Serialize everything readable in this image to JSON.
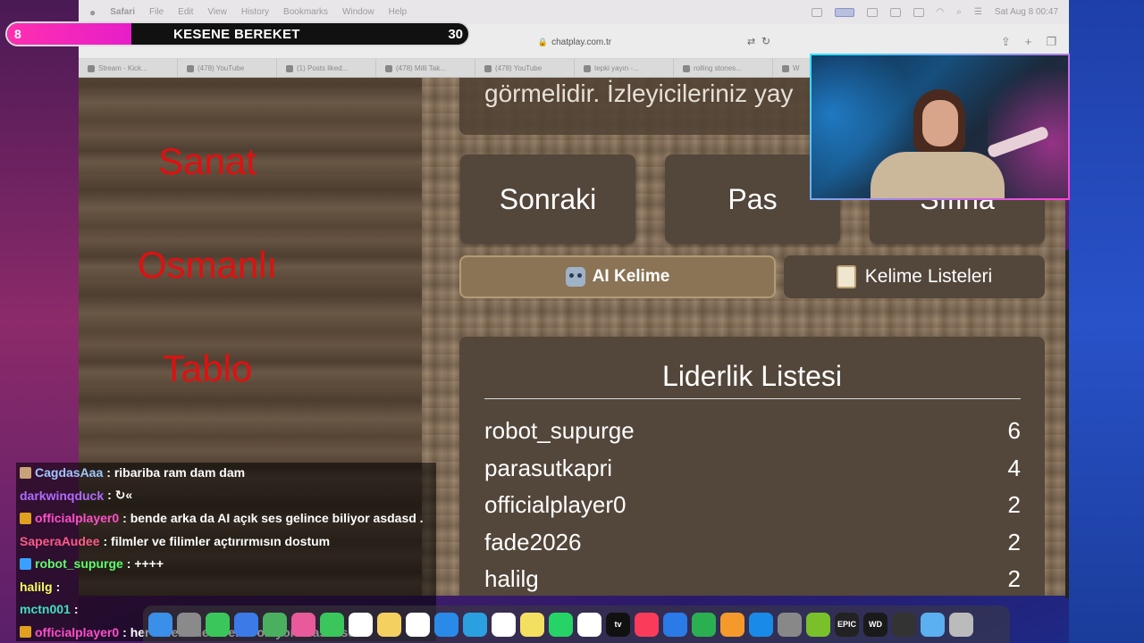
{
  "menubar": {
    "app": "Safari",
    "items": [
      "File",
      "Edit",
      "View",
      "History",
      "Bookmarks",
      "Window",
      "Help"
    ],
    "clock": "Sat Aug 8  00:47"
  },
  "toolbar": {
    "url": "chatplay.com.tr"
  },
  "tabs": [
    {
      "label": "Stream - Kick..."
    },
    {
      "label": "(478) YouTube"
    },
    {
      "label": "(1) Posts liked..."
    },
    {
      "label": "(478) Milli Tak..."
    },
    {
      "label": "(478) YouTube"
    },
    {
      "label": "tepki yayın -..."
    },
    {
      "label": "rolling stones..."
    },
    {
      "label": "W"
    }
  ],
  "overlay": {
    "left_value": "8",
    "title": "KESENE BEREKET",
    "right_value": "30",
    "progress_fraction": 0.27
  },
  "game": {
    "words": [
      "Sanat",
      "Osmanlı",
      "Tablo"
    ],
    "instruction": "görmelidir. İzleyicileriniz yay",
    "buttons": {
      "next": "Sonraki",
      "pass": "Pas",
      "reset": "Sıfırla",
      "ai": "AI Kelime",
      "lists": "Kelime Listeleri"
    },
    "leaderboard": {
      "title": "Liderlik Listesi",
      "rows": [
        {
          "name": "robot_supurge",
          "score": "6"
        },
        {
          "name": "parasutkapri",
          "score": "4"
        },
        {
          "name": "officialplayer0",
          "score": "2"
        },
        {
          "name": "fade2026",
          "score": "2"
        },
        {
          "name": "halilg",
          "score": "2"
        }
      ]
    }
  },
  "chat": [
    {
      "user": "CagdasAaa",
      "color": "#9ec7ff",
      "badge": "#c9a27a",
      "text": ": ribariba ram dam dam"
    },
    {
      "user": "darkwinqduck",
      "color": "#b06bff",
      "badge": "",
      "text": ": ↻«"
    },
    {
      "user": "officialplayer0",
      "color": "#ff4fc8",
      "badge": "#e0a020",
      "text": ": bende arka da AI açık ses gelince biliyor asdasd ."
    },
    {
      "user": "SaperaAudee",
      "color": "#ff5a8a",
      "badge": "",
      "text": ": filmler ve filimler açtırırmısın dostum"
    },
    {
      "user": "robot_supurge",
      "color": "#5dff6a",
      "badge": "#3aa0ff",
      "text": ": ++++"
    },
    {
      "user": "halilg",
      "color": "#f4ff5a",
      "badge": "",
      "text": ":"
    },
    {
      "user": "mctn001",
      "color": "#40e0c0",
      "badge": "",
      "text": ":"
    },
    {
      "user": "officialplayer0",
      "color": "#ff4fc8",
      "badge": "#e0a020",
      "text": ": her seferinde direk o oluyorsa asdasd .D"
    }
  ],
  "dock": {
    "icons": [
      "finder",
      "launchpad",
      "messages",
      "mail",
      "maps",
      "photos",
      "facetime",
      "calendar",
      "notes",
      "reminders",
      "safari",
      "telegram",
      "chrome",
      "stickies",
      "whatsapp",
      "freeform",
      "tv",
      "music",
      "keynote",
      "numbers",
      "pages",
      "appstore",
      "settings",
      "xbox",
      "epic",
      "wd",
      "monitor",
      "folder",
      "trash"
    ],
    "colors": [
      "#3a8fe8",
      "#8a8a8a",
      "#3ac65a",
      "#3a7be8",
      "#4ab060",
      "#e85a9a",
      "#3ac65a",
      "#ffffff",
      "#f4d060",
      "#ffffff",
      "#2a8ae8",
      "#2aa0e0",
      "#ffffff",
      "#f4e060",
      "#25d366",
      "#ffffff",
      "#111111",
      "#fa3c5a",
      "#2a7ae8",
      "#2ab050",
      "#f49a2a",
      "#1a8ae8",
      "#888888",
      "#7ac02a",
      "#222222",
      "#1a1a1a",
      "#333333",
      "#5ab0f0",
      "#bbbbbb"
    ],
    "labels": {
      "tv": "tv",
      "epic": "EPIC",
      "wd": "WD"
    }
  }
}
